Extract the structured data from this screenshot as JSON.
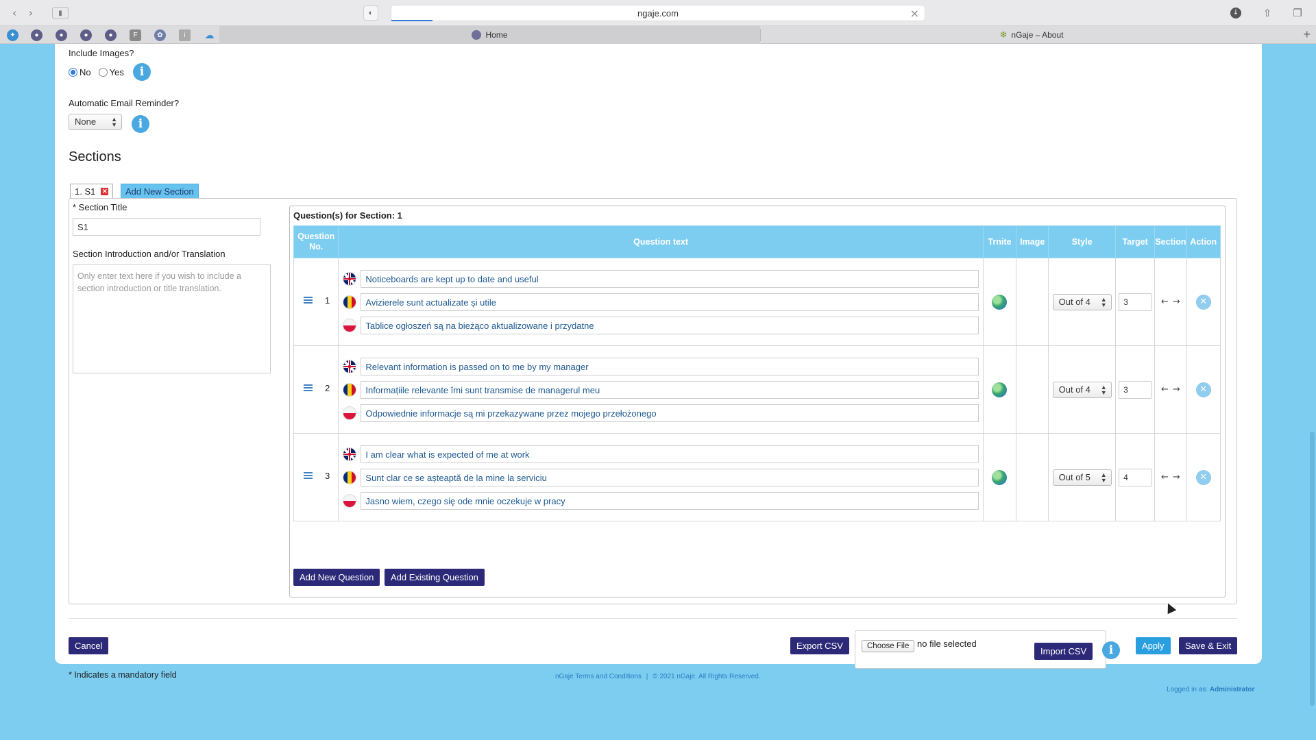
{
  "browser": {
    "url": "ngaje.com",
    "tabs": [
      {
        "label": "Home"
      },
      {
        "label": "nGaje – About"
      }
    ]
  },
  "form": {
    "include_images_label": "Include Images?",
    "include_images_no": "No",
    "include_images_yes": "Yes",
    "reminder_label": "Automatic Email Reminder?",
    "reminder_value": "None",
    "sections_heading": "Sections",
    "section_tab_label": "1. S1",
    "add_section_label": "Add New Section",
    "section_title_label": "* Section Title",
    "section_title_value": "S1",
    "section_intro_label": "Section Introduction and/or Translation",
    "section_intro_placeholder": "Only enter text here if you wish to include a section introduction or title translation."
  },
  "questions": {
    "title": "Question(s) for Section: 1",
    "headers": {
      "no_line1": "Question",
      "no_line2": "No.",
      "text": "Question text",
      "trnite": "Trnite",
      "image": "Image",
      "style": "Style",
      "target": "Target",
      "section": "Section",
      "action": "Action"
    },
    "rows": [
      {
        "no": "1",
        "en": "Noticeboards are kept up to date and useful",
        "ro": "Avizierele sunt actualizate și utile",
        "pl": "Tablice ogłoszeń są na bieżąco aktualizowane i przydatne",
        "style": "Out of 4",
        "target": "3"
      },
      {
        "no": "2",
        "en": "Relevant information is passed on to me by my manager",
        "ro": "Informațiile relevante îmi sunt transmise de managerul meu",
        "pl": "Odpowiednie informacje są mi przekazywane przez mojego przełożonego",
        "style": "Out of 4",
        "target": "3"
      },
      {
        "no": "3",
        "en": "I am clear what is expected of me at work",
        "ro": "Sunt clar ce se așteaptă de la mine la serviciu",
        "pl": "Jasno wiem, czego się ode mnie oczekuje w pracy",
        "style": "Out of 5",
        "target": "4"
      }
    ],
    "add_new_label": "Add New Question",
    "add_existing_label": "Add Existing Question"
  },
  "actions": {
    "cancel": "Cancel",
    "export_csv": "Export CSV",
    "choose_file": "Choose File",
    "no_file": "no file selected",
    "import_csv": "Import CSV",
    "apply": "Apply",
    "save_exit": "Save & Exit",
    "mandatory_note": "* Indicates a mandatory field"
  },
  "footer": {
    "terms": "nGaje Terms and Conditions",
    "separator": "|",
    "copyright": "© 2021 nGaje. All Rights Reserved.",
    "logged_in_prefix": "Logged in as:",
    "logged_in_user": "Administrator"
  },
  "colors": {
    "page_bg": "#7dcdf1",
    "header_bg": "#7dcdf1",
    "dark_button": "#2c2a78",
    "apply_button": "#2a9fe0"
  }
}
